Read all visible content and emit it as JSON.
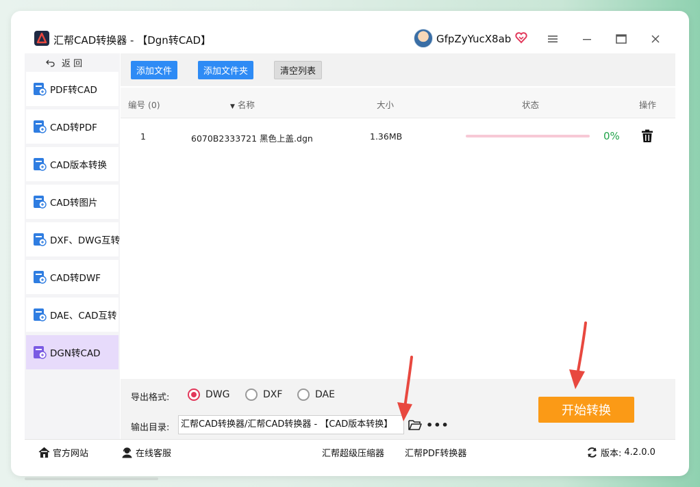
{
  "app": {
    "title": "汇帮CAD转换器 - 【Dgn转CAD】",
    "username": "GfpZyYucX8ab"
  },
  "titlebar": {
    "menu_icon": "hamburger-menu-icon",
    "minimize_icon": "minimize-icon",
    "maximize_icon": "maximize-icon",
    "close_icon": "close-icon"
  },
  "sidebar": {
    "back_label": "返 回",
    "items": [
      {
        "label": "PDF转CAD",
        "icon": "pdf-to-cad-icon",
        "active": false
      },
      {
        "label": "CAD转PDF",
        "icon": "cad-to-pdf-icon",
        "active": false
      },
      {
        "label": "CAD版本转换",
        "icon": "cad-version-icon",
        "active": false
      },
      {
        "label": "CAD转图片",
        "icon": "cad-to-image-icon",
        "active": false
      },
      {
        "label": "DXF、DWG互转",
        "icon": "dxf-dwg-icon",
        "active": false
      },
      {
        "label": "CAD转DWF",
        "icon": "cad-to-dwf-icon",
        "active": false
      },
      {
        "label": "DAE、CAD互转",
        "icon": "dae-cad-icon",
        "active": false
      },
      {
        "label": "DGN转CAD",
        "icon": "dgn-to-cad-icon",
        "active": true
      }
    ]
  },
  "toolbar": {
    "add_file": "添加文件",
    "add_folder": "添加文件夹",
    "clear_list": "清空列表"
  },
  "table": {
    "headers": {
      "index": "编号 (0)",
      "name": "名称",
      "size": "大小",
      "status": "状态",
      "action": "操作"
    },
    "rows": [
      {
        "index": "1",
        "name": "6070B2333721 黑色上盖.dgn",
        "size": "1.36MB",
        "progress": 0,
        "progress_text": "0%"
      }
    ]
  },
  "config": {
    "format_label": "导出格式:",
    "formats": [
      {
        "label": "DWG",
        "checked": true
      },
      {
        "label": "DXF",
        "checked": false
      },
      {
        "label": "DAE",
        "checked": false
      }
    ],
    "output_label": "输出目录:",
    "output_path": "汇帮CAD转换器/汇帮CAD转换器 - 【CAD版本转换】",
    "browse_icon": "folder-open-icon",
    "more_label": "•••",
    "start_button": "开始转换"
  },
  "statusbar": {
    "website": "官方网站",
    "support": "在线客服",
    "compressor": "汇帮超级压缩器",
    "pdf_converter": "汇帮PDF转换器",
    "version_label": "版本:",
    "version": "4.2.0.0"
  },
  "colors": {
    "primary_blue": "#2e8bf5",
    "start_orange": "#fb9a16",
    "active_sidebar": "#e7dbfb",
    "radio_checked": "#e2375a",
    "progress_green": "#21a34a",
    "progress_pink": "#f7c9d6",
    "annotation_red": "#e8483f"
  }
}
